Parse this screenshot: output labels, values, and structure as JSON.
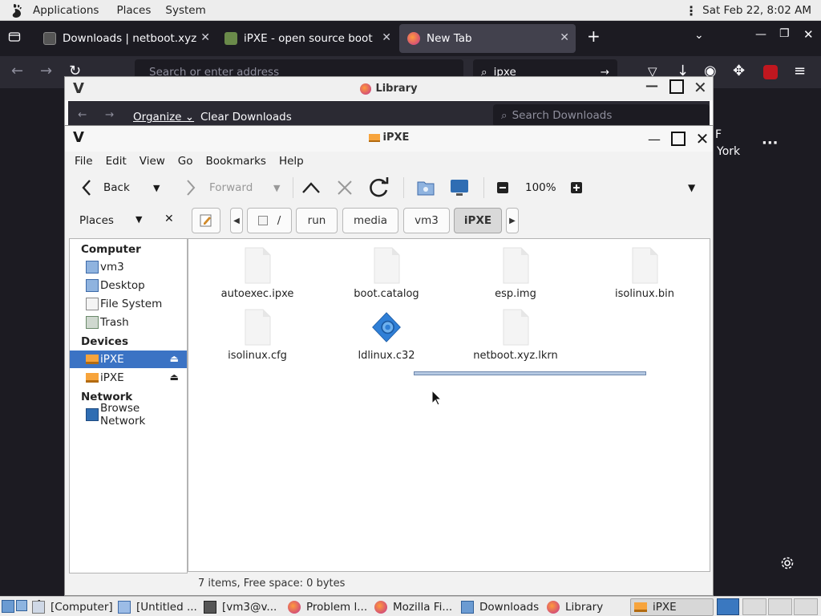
{
  "top_panel": {
    "menus": [
      "Applications",
      "Places",
      "System"
    ],
    "clock": "Sat Feb 22,  8:02 AM"
  },
  "firefox": {
    "tabs": [
      {
        "title": "Downloads | netboot.xyz",
        "active": false
      },
      {
        "title": "iPXE - open source boot firm",
        "active": false
      },
      {
        "title": "New Tab",
        "active": true
      }
    ],
    "url_placeholder": "Search or enter address",
    "search_value": "ipxe",
    "page_text_1": "F",
    "page_text_2": "York"
  },
  "library": {
    "title": "Library",
    "organize": "Organize",
    "clear_downloads": "Clear Downloads",
    "search_placeholder": "Search Downloads"
  },
  "nautilus": {
    "title": "iPXE",
    "menu": [
      "File",
      "Edit",
      "View",
      "Go",
      "Bookmarks",
      "Help"
    ],
    "toolbar": {
      "back": "Back",
      "forward": "Forward",
      "zoom": "100%"
    },
    "places_label": "Places",
    "breadcrumbs": [
      "/",
      "run",
      "media",
      "vm3",
      "iPXE"
    ],
    "sidebar": {
      "computer_header": "Computer",
      "computer_items": [
        "vm3",
        "Desktop",
        "File System",
        "Trash"
      ],
      "devices_header": "Devices",
      "devices_items": [
        "iPXE",
        "iPXE"
      ],
      "network_header": "Network",
      "network_items": [
        "Browse Network"
      ]
    },
    "files": [
      {
        "name": "autoexec.ipxe",
        "icon": "file-icon"
      },
      {
        "name": "boot.catalog",
        "icon": "file-icon"
      },
      {
        "name": "esp.img",
        "icon": "file-icon"
      },
      {
        "name": "isolinux.bin",
        "icon": "file-icon"
      },
      {
        "name": "isolinux.cfg",
        "icon": "file-icon"
      },
      {
        "name": "ldlinux.c32",
        "icon": "executable-icon"
      },
      {
        "name": "netboot.xyz.lkrn",
        "icon": "file-icon"
      }
    ],
    "status": "7 items, Free space: 0 bytes"
  },
  "taskbar": {
    "tasks": [
      {
        "label": "[Computer]"
      },
      {
        "label": "[Untitled ..."
      },
      {
        "label": "[vm3@v..."
      },
      {
        "label": "Problem l..."
      },
      {
        "label": "Mozilla Fi..."
      },
      {
        "label": "Downloads"
      },
      {
        "label": "Library"
      },
      {
        "label": "iPXE",
        "active": true
      }
    ]
  },
  "colors": {
    "selection": "#3b73c4",
    "firefox_dark": "#1c1b22",
    "firefox_toolbar": "#2b2a33"
  }
}
